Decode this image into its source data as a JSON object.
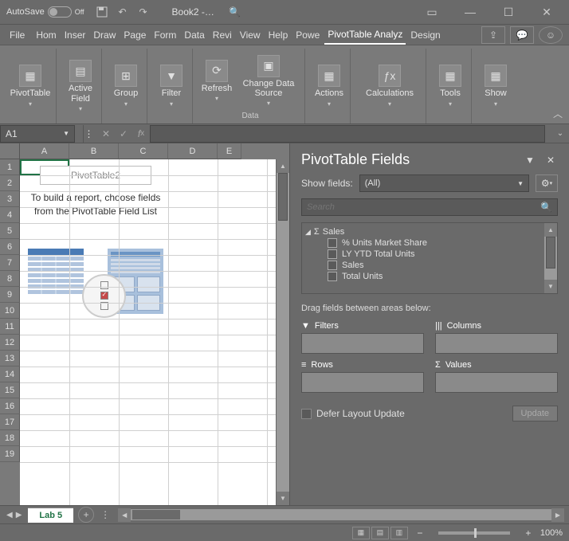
{
  "titlebar": {
    "autosave_label": "AutoSave",
    "autosave_state": "Off",
    "book_title": "Book2 -…"
  },
  "ribbon_tabs": [
    "File",
    "Hom",
    "Inser",
    "Draw",
    "Page",
    "Form",
    "Data",
    "Revi",
    "View",
    "Help",
    "Powe",
    "PivotTable Analyz",
    "Design"
  ],
  "active_ribbon_tab": "PivotTable Analyz",
  "ribbon_groups": {
    "pivottable": "PivotTable",
    "active_field": "Active Field",
    "group": "Group",
    "filter": "Filter",
    "refresh": "Refresh",
    "change_data": "Change Data Source",
    "data_label": "Data",
    "actions": "Actions",
    "calculations": "Calculations",
    "tools": "Tools",
    "show": "Show"
  },
  "namebox": "A1",
  "columns": [
    "A",
    "B",
    "C",
    "D",
    "E"
  ],
  "rows": [
    "1",
    "2",
    "3",
    "4",
    "5",
    "6",
    "7",
    "8",
    "9",
    "10",
    "11",
    "12",
    "13",
    "14",
    "15",
    "16",
    "17",
    "18",
    "19"
  ],
  "pivot_placeholder": {
    "title": "PivotTable2",
    "text": "To build a report, choose fields from the PivotTable Field List"
  },
  "sheet_tab": "Lab 5",
  "fields_pane": {
    "title": "PivotTable Fields",
    "show_fields_label": "Show fields:",
    "show_fields_value": "(All)",
    "search_placeholder": "Search",
    "group_name": "Sales",
    "items": [
      "% Units Market Share",
      "LY YTD Total Units",
      "Sales",
      "Total Units"
    ],
    "drag_hint": "Drag fields between areas below:",
    "areas": {
      "filters": "Filters",
      "columns": "Columns",
      "rows": "Rows",
      "values": "Values"
    },
    "defer_label": "Defer Layout Update",
    "update_btn": "Update"
  },
  "zoom": "100%"
}
